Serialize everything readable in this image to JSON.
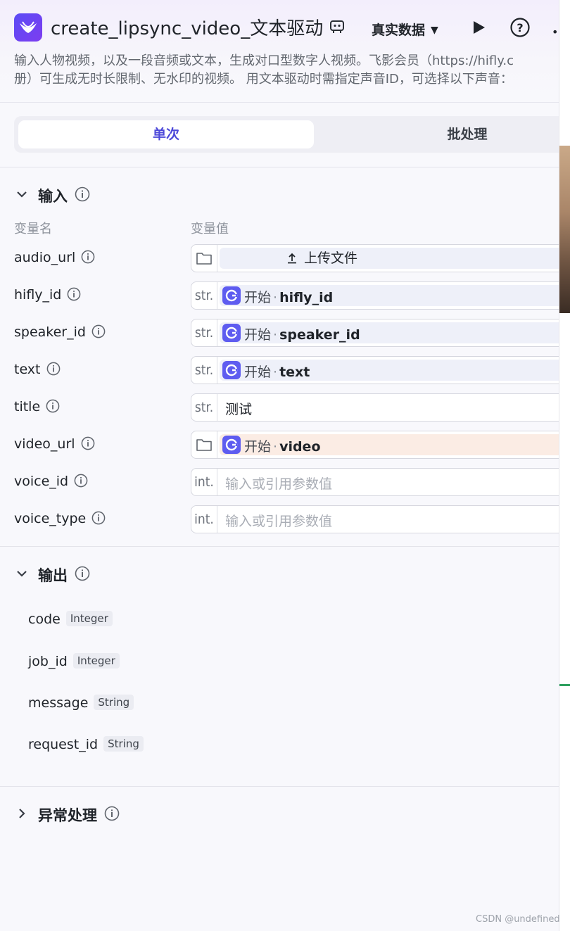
{
  "header": {
    "title": "create_lipsync_video_文本驱动",
    "data_mode": "真实数据",
    "description_line1": "输入人物视频，以及一段音频或文本，生成对口型数字人视频。飞影会员（https://hifly.c",
    "description_line2": "册）可生成无时长限制、无水印的视频。 用文本驱动时需指定声音ID，可选择以下声音："
  },
  "tabs": [
    {
      "label": "单次",
      "active": true
    },
    {
      "label": "批处理",
      "active": false
    }
  ],
  "input_section": {
    "title": "输入",
    "col_name": "变量名",
    "col_value": "变量值",
    "rows": [
      {
        "name": "audio_url",
        "kind": "upload",
        "upload_label": "上传文件"
      },
      {
        "name": "hifly_id",
        "prefix": "str.",
        "kind": "ref",
        "ref_node": "开始",
        "ref_sep": "·",
        "ref_var": "hifly_id"
      },
      {
        "name": "speaker_id",
        "prefix": "str.",
        "kind": "ref",
        "ref_node": "开始",
        "ref_sep": "·",
        "ref_var": "speaker_id"
      },
      {
        "name": "text",
        "prefix": "str.",
        "kind": "ref",
        "ref_node": "开始",
        "ref_sep": "·",
        "ref_var": "text"
      },
      {
        "name": "title",
        "prefix": "str.",
        "kind": "text",
        "value": "测试"
      },
      {
        "name": "video_url",
        "kind": "ref-file",
        "ref_node": "开始",
        "ref_sep": "·",
        "ref_var": "video"
      },
      {
        "name": "voice_id",
        "prefix": "int.",
        "kind": "empty",
        "placeholder": "输入或引用参数值"
      },
      {
        "name": "voice_type",
        "prefix": "int.",
        "kind": "empty",
        "placeholder": "输入或引用参数值"
      }
    ]
  },
  "output_section": {
    "title": "输出",
    "items": [
      {
        "name": "code",
        "type": "Integer"
      },
      {
        "name": "job_id",
        "type": "Integer"
      },
      {
        "name": "message",
        "type": "String"
      },
      {
        "name": "request_id",
        "type": "String"
      }
    ]
  },
  "exception_section": {
    "title": "异常处理"
  },
  "watermark": "CSDN @undefined",
  "colors": {
    "accent": "#4e4ad9",
    "ref_icon": "#5e5cf0",
    "warn_chip": "#fbece4"
  }
}
